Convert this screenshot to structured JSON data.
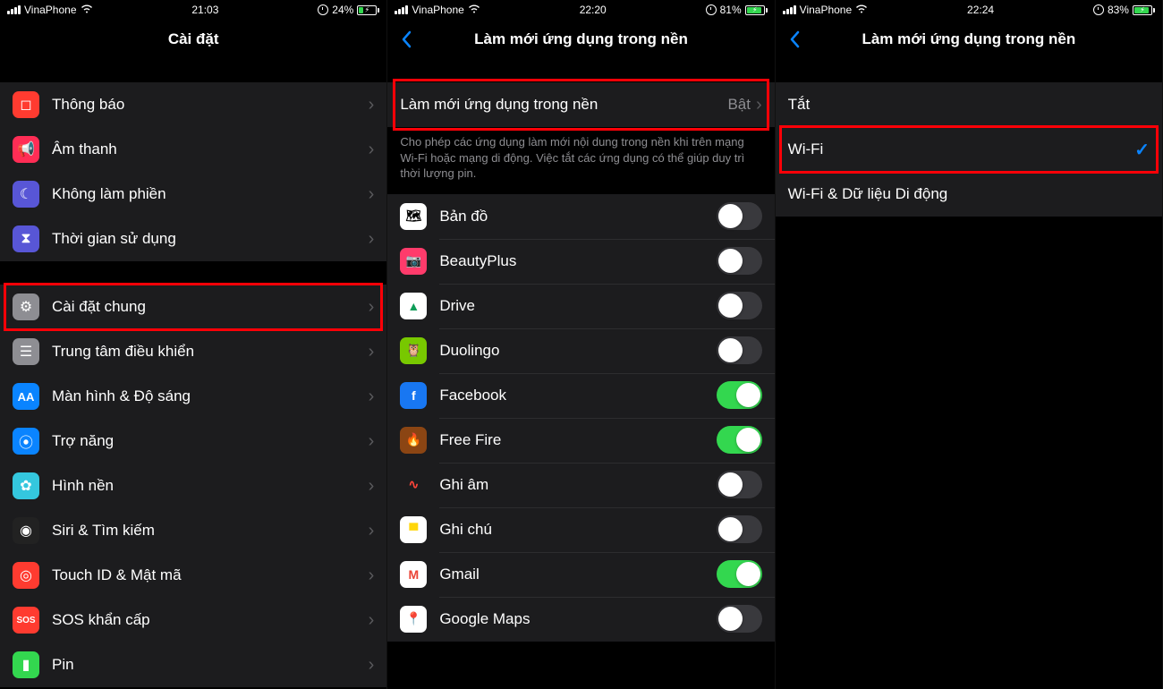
{
  "screen1": {
    "status": {
      "carrier": "VinaPhone",
      "time": "21:03",
      "battery_pct": "24%",
      "battery_fill": 24
    },
    "title": "Cài đặt",
    "groups": [
      [
        {
          "icon": "notif",
          "iconBg": "#ff3b30",
          "label": "Thông báo"
        },
        {
          "icon": "sound",
          "iconBg": "#ff2d55",
          "label": "Âm thanh"
        },
        {
          "icon": "moon",
          "iconBg": "#5856d6",
          "label": "Không làm phiền"
        },
        {
          "icon": "hourglass",
          "iconBg": "#5856d6",
          "label": "Thời gian sử dụng"
        }
      ],
      [
        {
          "icon": "gear",
          "iconBg": "#8e8e93",
          "label": "Cài đặt chung",
          "highlight": true
        },
        {
          "icon": "control",
          "iconBg": "#8e8e93",
          "label": "Trung tâm điều khiển"
        },
        {
          "icon": "display",
          "iconBg": "#0a84ff",
          "label": "Màn hình & Độ sáng"
        },
        {
          "icon": "access",
          "iconBg": "#0a84ff",
          "label": "Trợ năng"
        },
        {
          "icon": "wallpaper",
          "iconBg": "#34c7de",
          "label": "Hình nền"
        },
        {
          "icon": "siri",
          "iconBg": "#222",
          "label": "Siri & Tìm kiếm"
        },
        {
          "icon": "touchid",
          "iconBg": "#ff3b30",
          "label": "Touch ID & Mật mã"
        },
        {
          "icon": "sos",
          "iconBg": "#ff3b30",
          "label": "SOS khẩn cấp"
        },
        {
          "icon": "battery",
          "iconBg": "#33d74f",
          "label": "Pin"
        }
      ]
    ]
  },
  "screen2": {
    "status": {
      "carrier": "VinaPhone",
      "time": "22:20",
      "battery_pct": "81%",
      "battery_fill": 81
    },
    "title": "Làm mới ứng dụng trong nền",
    "master": {
      "label": "Làm mới ứng dụng trong nền",
      "value": "Bật"
    },
    "footer": "Cho phép các ứng dụng làm mới nội dung trong nền khi trên mạng Wi-Fi hoặc mạng di động. Việc tắt các ứng dụng có thể giúp duy trì thời lượng pin.",
    "apps": [
      {
        "name": "Bản đồ",
        "bg": "#fff",
        "txt": "🗺",
        "on": false
      },
      {
        "name": "BeautyPlus",
        "bg": "#ff3b6b",
        "txt": "📷",
        "on": false
      },
      {
        "name": "Drive",
        "bg": "#fff",
        "txt": "▲",
        "tc": "#0f9d58",
        "on": false
      },
      {
        "name": "Duolingo",
        "bg": "#78c800",
        "txt": "🦉",
        "on": false
      },
      {
        "name": "Facebook",
        "bg": "#1877f2",
        "txt": "f",
        "tc": "#fff",
        "on": true
      },
      {
        "name": "Free Fire",
        "bg": "#8b4513",
        "txt": "🔥",
        "on": true
      },
      {
        "name": "Ghi âm",
        "bg": "#1c1c1e",
        "txt": "∿",
        "tc": "#ff453a",
        "on": false
      },
      {
        "name": "Ghi chú",
        "bg": "#fff",
        "txt": "▀",
        "tc": "#ffd60a",
        "on": false
      },
      {
        "name": "Gmail",
        "bg": "#fff",
        "txt": "M",
        "tc": "#ea4335",
        "on": true
      },
      {
        "name": "Google Maps",
        "bg": "#fff",
        "txt": "📍",
        "on": false
      }
    ]
  },
  "screen3": {
    "status": {
      "carrier": "VinaPhone",
      "time": "22:24",
      "battery_pct": "83%",
      "battery_fill": 83
    },
    "title": "Làm mới ứng dụng trong nền",
    "options": [
      {
        "label": "Tắt",
        "checked": false
      },
      {
        "label": "Wi-Fi",
        "checked": true,
        "highlight": true
      },
      {
        "label": "Wi-Fi & Dữ liệu Di động",
        "checked": false
      }
    ]
  },
  "icons": {
    "notif": "◻",
    "sound": "📢",
    "moon": "☾",
    "hourglass": "⧗",
    "gear": "⚙",
    "control": "☰",
    "display": "AA",
    "access": "⦿",
    "wallpaper": "✿",
    "siri": "◉",
    "touchid": "◎",
    "sos": "SOS",
    "battery": "▮"
  }
}
